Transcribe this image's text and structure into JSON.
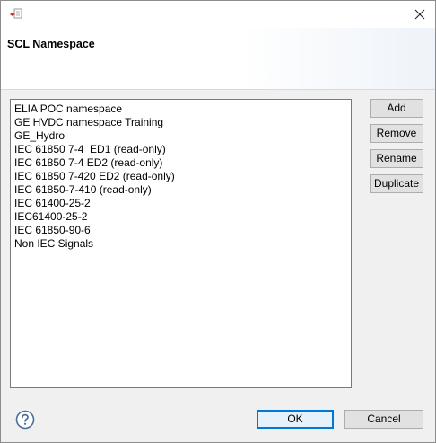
{
  "window": {
    "title": "",
    "close_glyph": "×"
  },
  "banner": {
    "title": "SCL Namespace"
  },
  "namespaces": [
    "ELIA POC namespace",
    "GE HVDC namespace Training",
    "GE_Hydro",
    "IEC 61850 7-4  ED1 (read-only)",
    "IEC 61850 7-4 ED2 (read-only)",
    "IEC 61850 7-420 ED2 (read-only)",
    "IEC 61850-7-410 (read-only)",
    "IEC 61400-25-2",
    "IEC61400-25-2",
    "IEC 61850-90-6",
    "Non IEC Signals"
  ],
  "actions": {
    "add": "Add",
    "remove": "Remove",
    "rename": "Rename",
    "duplicate": "Duplicate"
  },
  "footer": {
    "ok": "OK",
    "cancel": "Cancel"
  },
  "icons": {
    "app": "app-icon",
    "close": "close-icon",
    "help": "help-icon"
  },
  "colors": {
    "accent": "#0078d7",
    "help_icon": "#4a6f96",
    "button_bg": "#e1e1e1"
  }
}
